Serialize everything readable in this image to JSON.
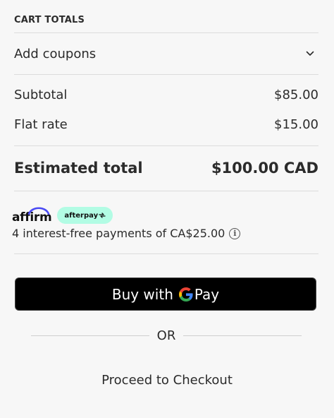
{
  "cart": {
    "heading": "CART TOTALS",
    "coupons_label": "Add coupons",
    "subtotal_label": "Subtotal",
    "subtotal_value": "$85.00",
    "shipping_label": "Flat rate",
    "shipping_value": "$15.00",
    "total_label": "Estimated total",
    "total_value": "$100.00 CAD"
  },
  "bnpl": {
    "affirm_logo": "affirm",
    "afterpay_logo": "afterpay",
    "message": "4 interest-free payments of CA$25.00",
    "info_glyph": "i",
    "afterpay_color": "#b2fce4",
    "affirm_color": "#4a4af4"
  },
  "payment": {
    "gpay_prefix": "Buy with",
    "gpay_suffix": "Pay",
    "or_label": "OR",
    "checkout_label": "Proceed to Checkout"
  },
  "icons": {
    "coupon_toggle": "chevron-down-icon",
    "info": "info-icon",
    "google": "google-g-icon"
  }
}
